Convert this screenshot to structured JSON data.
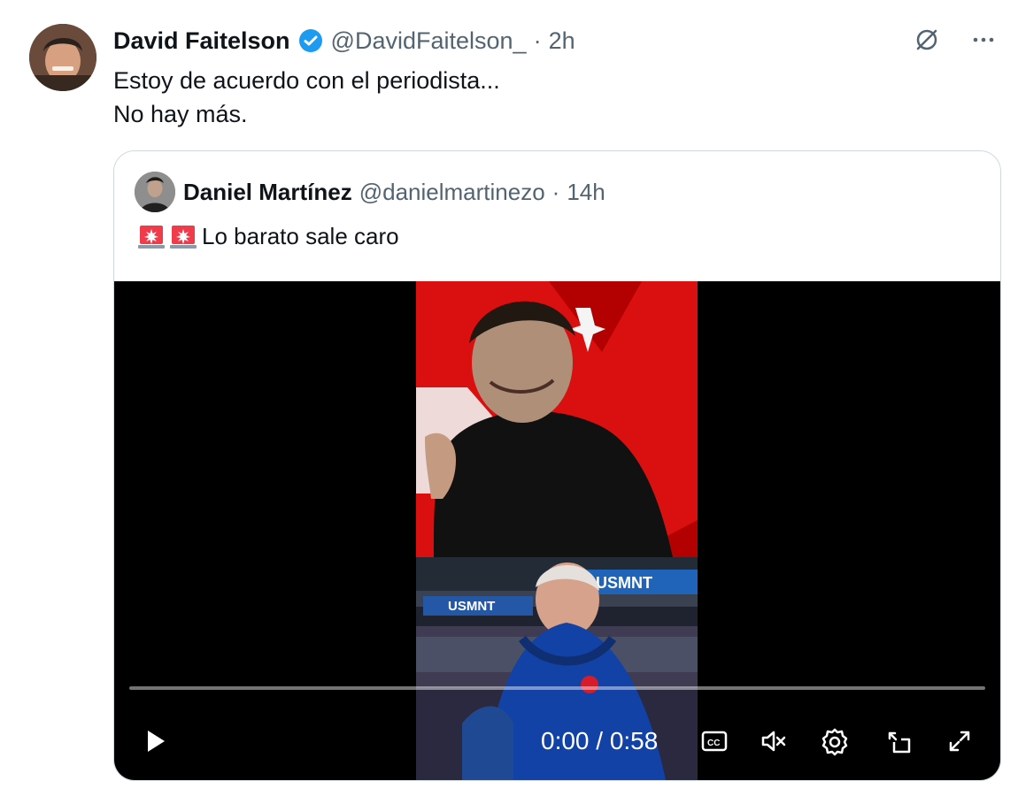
{
  "tweet": {
    "name": "David Faitelson",
    "handle": "@DavidFaitelson_",
    "separator": "·",
    "time": "2h",
    "text_line1": "Estoy de acuerdo con el periodista...",
    "text_line2": "No hay más."
  },
  "quote": {
    "name": "Daniel Martínez",
    "handle": "@danielmartinezo",
    "separator": "·",
    "time": "14h",
    "text": "Lo barato sale caro",
    "emoji": [
      "police-car-light",
      "police-car-light"
    ]
  },
  "video": {
    "time_readout": "0:00 / 0:58",
    "progress": 0,
    "overlay_text_1": "USMNT",
    "overlay_text_2": "USMNT"
  },
  "colors": {
    "text": "#0f1419",
    "muted": "#536471",
    "verified": "#1d9bf0",
    "border": "#cfd9de",
    "video_bg": "#000000"
  },
  "icons": {
    "verified": "verified-badge-icon",
    "grok": "grok-icon",
    "more": "more-icon",
    "play": "play-icon",
    "captions": "captions-icon",
    "mute": "mute-icon",
    "settings": "settings-icon",
    "pip": "picture-in-picture-icon",
    "fullscreen": "fullscreen-icon"
  }
}
